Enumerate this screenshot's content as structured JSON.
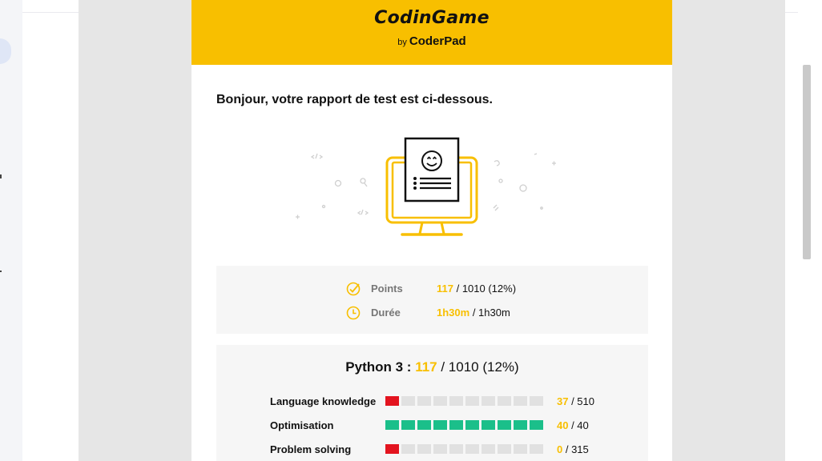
{
  "colors": {
    "brand_yellow": "#f8bf00",
    "bar_red": "#e3141f",
    "bar_green": "#1bbf8a",
    "bar_empty": "#e1e1e1"
  },
  "header": {
    "logo_text": "CodinGame",
    "logo_by": "by",
    "logo_sub": "CoderPad"
  },
  "greeting": "Bonjour, votre rapport de test est ci-dessous.",
  "illustration": {
    "icon": "computer-report-smiley-icon"
  },
  "summary": {
    "points": {
      "icon": "check-circle-icon",
      "label": "Points",
      "score": "117",
      "rest": " / 1010 (12%)"
    },
    "duration": {
      "icon": "clock-icon",
      "label": "Durée",
      "score": "1h30m",
      "rest": " / 1h30m"
    }
  },
  "language": {
    "name": "Python 3 :",
    "score": "117",
    "rest": " / 1010 (12%)",
    "skills": [
      {
        "name": "Language knowledge",
        "score": "37",
        "total": " / 510",
        "filled_segments": 1,
        "total_segments": 10,
        "fill_color": "red"
      },
      {
        "name": "Optimisation",
        "score": "40",
        "total": " / 40",
        "filled_segments": 10,
        "total_segments": 10,
        "fill_color": "green"
      },
      {
        "name": "Problem solving",
        "score": "0",
        "total": " / 315",
        "filled_segments": 1,
        "total_segments": 10,
        "fill_color": "red"
      }
    ]
  }
}
